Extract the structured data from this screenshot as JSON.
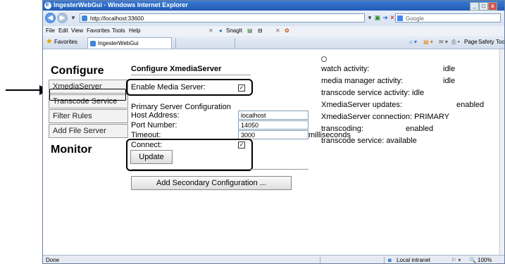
{
  "window": {
    "title": "IngesterWebGui - Windows Internet Explorer",
    "min": "_",
    "max": "□",
    "close": "x"
  },
  "address": {
    "url": "http://localhost:33600"
  },
  "search": {
    "placeholder": "Google"
  },
  "menu": {
    "file": "File",
    "edit": "Edit",
    "view": "View",
    "favorites": "Favorites",
    "tools": "Tools",
    "help": "Help",
    "snagit": "SnagIt"
  },
  "favbar": {
    "favorites": "Favorites",
    "tab": "IngesterWebGui",
    "page": "Page",
    "safety": "Safety",
    "tools": "Tools"
  },
  "sidebar": {
    "configure": "Configure",
    "items": [
      "XmediaServer",
      "Transcode Service",
      "Filter Rules",
      "Add File Server"
    ],
    "monitor": "Monitor"
  },
  "main": {
    "title": "Configure XmediaServer",
    "enable_label": "Enable Media Server:",
    "enable_checked": "✓",
    "primary_heading": "Primary Server Configuration",
    "host_label": "Host Address:",
    "host_value": "localhost",
    "port_label": "Port Number:",
    "port_value": "14050",
    "timeout_label": "Timeout:",
    "timeout_value": "3000",
    "timeout_unit": "milliseconds",
    "connect_label": "Connect:",
    "connect_checked": "✓",
    "update_button": "Update",
    "add_secondary_button": "Add Secondary Configuration ..."
  },
  "status": {
    "watch": "watch activity:",
    "watch_val": "idle",
    "mm": "media manager activity:",
    "mm_val": "idle",
    "transcode_service": "transcode service activity: idle",
    "xms_updates": "XmediaServer updates:",
    "xms_updates_val": "enabled",
    "xms_connection": "XmediaServer connection: PRIMARY",
    "transcoding": "transcoding:",
    "transcoding_val": "enabled",
    "transcode_avail": "transcode service: available"
  },
  "statusbar": {
    "done": "Done",
    "zone": "Local intranet",
    "zoom": "100%"
  }
}
